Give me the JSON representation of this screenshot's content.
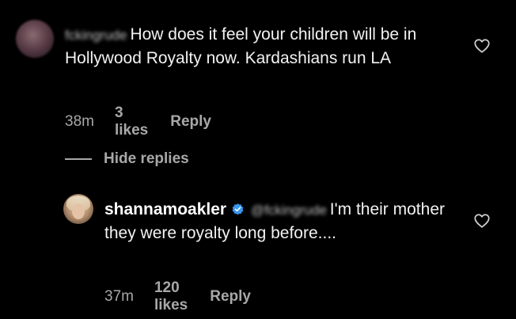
{
  "comments": [
    {
      "handle": "fckingrude",
      "text": "How does it feel your children will be in Hollywood Royalty now. Kardashians run LA",
      "time": "38m",
      "likes": "3 likes",
      "reply_label": "Reply"
    }
  ],
  "hide_replies_label": "Hide replies",
  "reply": {
    "username": "shannamoakler",
    "mention": "@fckingrude",
    "text": "I'm their mother they were royalty long before....",
    "time": "37m",
    "likes": "120 likes",
    "reply_label": "Reply"
  },
  "colors": {
    "background": "#000000",
    "primary_text": "#f2f2f2",
    "secondary_text": "#a8a8a8",
    "verified_badge": "#3897f0"
  },
  "icons": {
    "like": "heart-outline-icon",
    "verified": "verified-badge-icon"
  }
}
